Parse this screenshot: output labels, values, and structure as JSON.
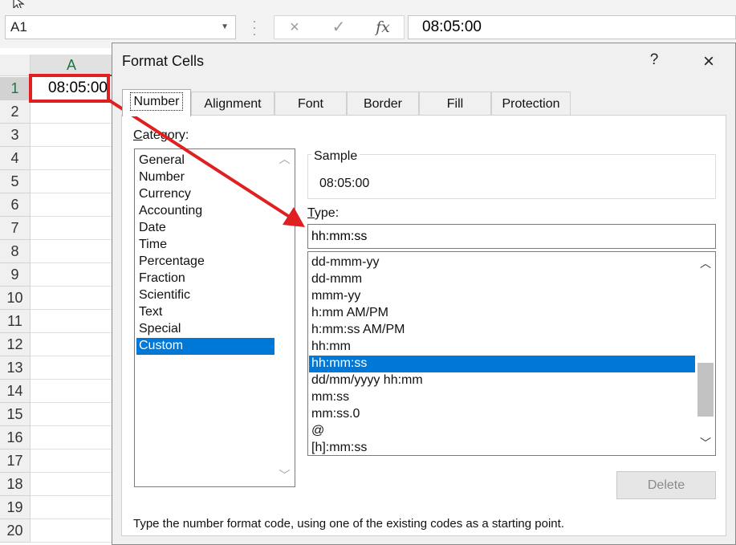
{
  "excel": {
    "name_box": "A1",
    "formula_value": "08:05:00",
    "column_header": "A",
    "row_numbers": [
      "1",
      "2",
      "3",
      "4",
      "5",
      "6",
      "7",
      "8",
      "9",
      "10",
      "11",
      "12",
      "13",
      "14",
      "15",
      "16",
      "17",
      "18",
      "19",
      "20"
    ],
    "cell_a1": "08:05:00",
    "icons": {
      "cancel": "×",
      "enter": "✓",
      "fx": "fx"
    }
  },
  "dialog": {
    "title": "Format Cells",
    "help": "?",
    "close": "×",
    "tabs": [
      "Number",
      "Alignment",
      "Font",
      "Border",
      "Fill",
      "Protection"
    ],
    "active_tab": "Number",
    "category_label": "Category:",
    "categories": [
      "General",
      "Number",
      "Currency",
      "Accounting",
      "Date",
      "Time",
      "Percentage",
      "Fraction",
      "Scientific",
      "Text",
      "Special",
      "Custom"
    ],
    "selected_category": "Custom",
    "sample_label": "Sample",
    "sample_value": "08:05:00",
    "type_label": "Type:",
    "type_value": "hh:mm:ss",
    "type_list": [
      "dd-mmm-yy",
      "dd-mmm",
      "mmm-yy",
      "h:mm AM/PM",
      "h:mm:ss AM/PM",
      "hh:mm",
      "hh:mm:ss",
      "dd/mm/yyyy hh:mm",
      "mm:ss",
      "mm:ss.0",
      "@",
      "[h]:mm:ss"
    ],
    "selected_type": "hh:mm:ss",
    "delete_label": "Delete",
    "hint": "Type the number format code, using one of the existing codes as a starting point."
  },
  "colors": {
    "accent": "#0078d7",
    "excel_green": "#217346",
    "annotation_red": "#e02020"
  }
}
